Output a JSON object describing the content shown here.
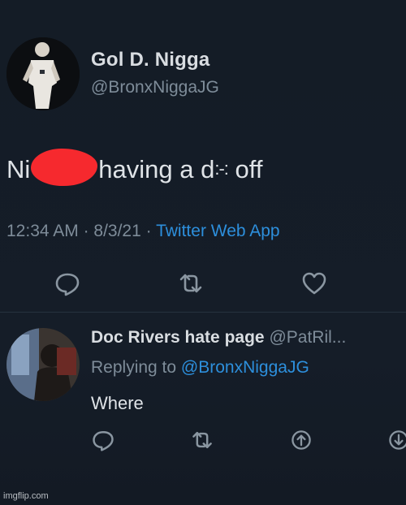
{
  "main_tweet": {
    "display_name": "Gol D. Nigga",
    "handle": "@BronxNiggaJG",
    "text_before": "Ni",
    "text_after": "having a d",
    "text_obscured": ":-:",
    "text_end": " off",
    "time": "12:34 AM",
    "sep1": " · ",
    "date": "8/3/21",
    "sep2": " · ",
    "source": "Twitter Web App",
    "icons": [
      "reply-icon",
      "retweet-icon",
      "like-icon"
    ]
  },
  "reply_tweet": {
    "display_name": "Doc Rivers hate page",
    "handle": "@PatRil...",
    "replying_prefix": "Replying to ",
    "replying_to": "@BronxNiggaJG",
    "text": "Where",
    "icons": [
      "reply-icon",
      "retweet-icon",
      "share-icon",
      "download-icon"
    ]
  },
  "watermark": "imgflip.com",
  "colors": {
    "background": "#15202b",
    "link": "#2d8fdc",
    "secondary_text": "#7e8c99",
    "primary_text": "#dfe3e7",
    "redaction": "#f6292e"
  }
}
